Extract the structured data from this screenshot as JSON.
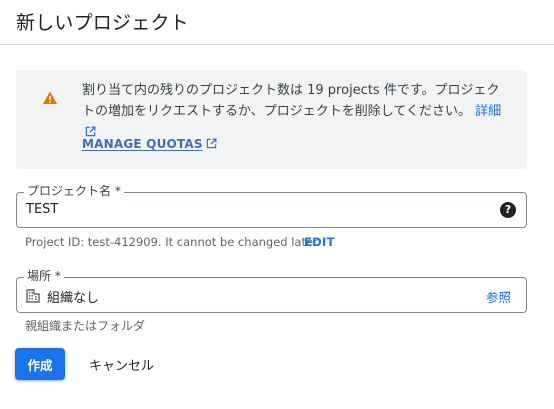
{
  "page": {
    "title": "新しいプロジェクト"
  },
  "quota_banner": {
    "icon": "warning-icon",
    "message": "割り当て内の残りのプロジェクト数は 19 projects 件です。プロジェクトの増加をリクエストするか、プロジェクトを削除してください。",
    "details_link": "詳細",
    "manage_quotas_link": "MANAGE QUOTAS",
    "warning_color": "#e37400"
  },
  "project_name": {
    "label": "プロジェクト名 *",
    "value": "TEST",
    "help_icon": "help-icon",
    "hint": "Project ID: test-412909. It cannot be changed later.",
    "edit_link": "EDIT"
  },
  "location": {
    "label": "場所 *",
    "icon": "organization-icon",
    "value": "組織なし",
    "browse_link": "参照",
    "hint": "親組織またはフォルダ"
  },
  "actions": {
    "create_label": "作成",
    "cancel_label": "キャンセル"
  },
  "colors": {
    "primary": "#1a73e8",
    "banner_bg": "#f1f3f4",
    "border": "#80868b"
  }
}
